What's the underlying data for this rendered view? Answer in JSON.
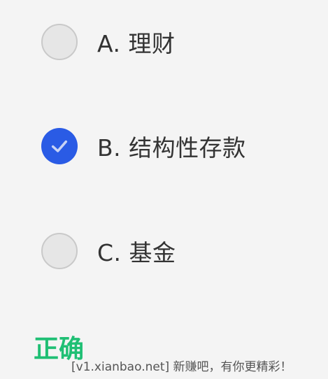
{
  "options": [
    {
      "label": "A. 理财",
      "selected": false
    },
    {
      "label": "B. 结构性存款",
      "selected": true
    },
    {
      "label": "C. 基金",
      "selected": false
    }
  ],
  "result": {
    "text": "正确",
    "color": "#1fbf74"
  },
  "watermark": {
    "text": "[v1.xianbao.net] 新赚吧，有你更精彩！"
  },
  "colors": {
    "selected": "#2a5be5",
    "unselected": "#e6e6e6",
    "background": "#f4f4f4"
  },
  "icons": {
    "selected_mark": "check-icon"
  }
}
